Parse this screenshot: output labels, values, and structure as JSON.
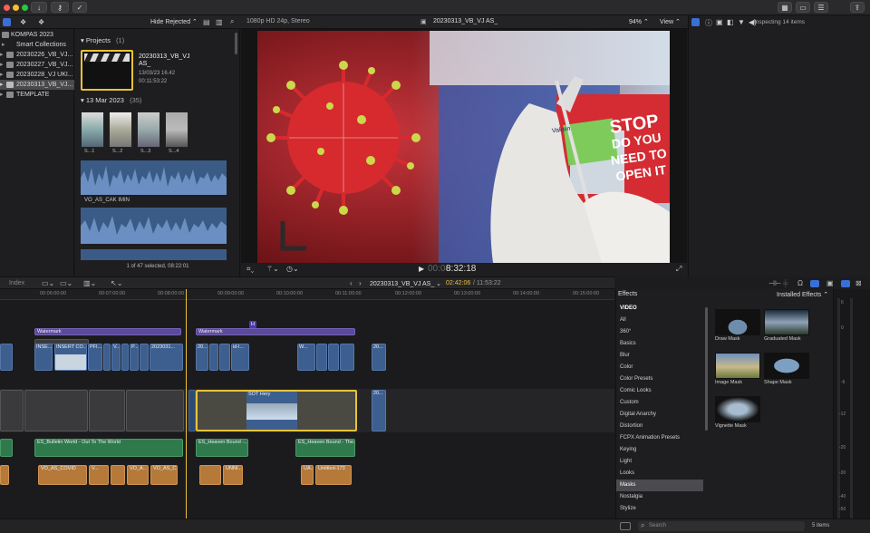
{
  "toolbar": {
    "hide_rejected": "Hide Rejected",
    "format": "1080p HD 24p, Stereo",
    "project_name": "20230313_VB_VJ AS_",
    "zoom": "94%",
    "view": "View",
    "inspecting": "Inspecting 14 items"
  },
  "libraries": {
    "items": [
      {
        "label": "KOMPAS 2023"
      },
      {
        "label": "Smart Collections"
      },
      {
        "label": "20230226_VB_VJ..."
      },
      {
        "label": "20230227_VB_VJ..."
      },
      {
        "label": "20230228_VJ UKI..."
      },
      {
        "label": "20230313_VB_VJ..."
      },
      {
        "label": "TEMPLATE"
      }
    ]
  },
  "browser": {
    "projects_header": "Projects",
    "projects_count": "(1)",
    "project": {
      "name": "20230313_VB_VJ AS_",
      "date": "13/03/23 16.42",
      "duration": "00:11:53:22"
    },
    "date_header": "13 Mar 2023",
    "date_count": "(35)",
    "thumbs": [
      "S...1",
      "S...2",
      "S...3",
      "S...4"
    ],
    "audio_clip": "VO_AS_CAK IMIN",
    "status": "1 of 47 selected, 08:22:01"
  },
  "viewer": {
    "sign_line1": "STOP",
    "sign_line2": "DO YOU",
    "sign_line3": "NEED TO",
    "sign_line4": "OPEN IT",
    "vial_label": "Vaksin",
    "timecode": "8:32:18",
    "timecode_prefix": "00:00"
  },
  "timeline": {
    "index_label": "Index",
    "project": "20230313_VB_VJ AS_",
    "position": "02:42:06",
    "duration": "/ 11:53:22",
    "ruler": [
      "00:06:00:00",
      "00:07:00:00",
      "00:08:00:00",
      "00:09:00:00",
      "00:10:00:00",
      "00:11:00:00",
      "00:12:00:00",
      "00:13:00:00",
      "00:14:00:00",
      "00:15:00:00"
    ],
    "watermark": "Watermark",
    "marker": "H",
    "clip_insert1": "INSE...",
    "clip_insert2": "INSERT CO...",
    "clip_pf": "PFI...",
    "clip_v": "V...",
    "clip_p": "P...",
    "clip_2023": "2023031...",
    "clip_20": "20...",
    "clip_id": "id-l...",
    "clip_w": "W...",
    "clip_sot": "SOT Hery",
    "music1": "ES_Bulletin World - Out To The World",
    "music2": "ES_Heaven Bound -...",
    "music3": "ES_Heaven Bound - The...",
    "vo1": "VO_AS_COVID",
    "vo_v": "V...",
    "vo_va": "VO_A...",
    "vo_vac": "VO_AS_C...",
    "vo_unni": "UNNI...",
    "vo_ua": "UA...",
    "vo_untitled": "Untitled-173"
  },
  "effects": {
    "header": "Effects",
    "installed": "Installed Effects",
    "categories": [
      "VIDEO",
      "All",
      "360°",
      "Basics",
      "Blur",
      "Color",
      "Color Presets",
      "Comic Looks",
      "Custom",
      "Digital Anarchy",
      "Distortion",
      "FCPX Animation Presets",
      "Keying",
      "Light",
      "Looks",
      "Masks",
      "Nostalgia",
      "Stylize"
    ],
    "selected": "Masks",
    "tiles": [
      "Draw Mask",
      "Graduated Mask",
      "Image Mask",
      "Shape Mask",
      "Vignette Mask"
    ],
    "search_placeholder": "Search",
    "count": "5 items"
  },
  "meters": {
    "ticks": [
      "6",
      "0",
      "-6",
      "-12",
      "-20",
      "-30",
      "-40",
      "-50"
    ]
  }
}
